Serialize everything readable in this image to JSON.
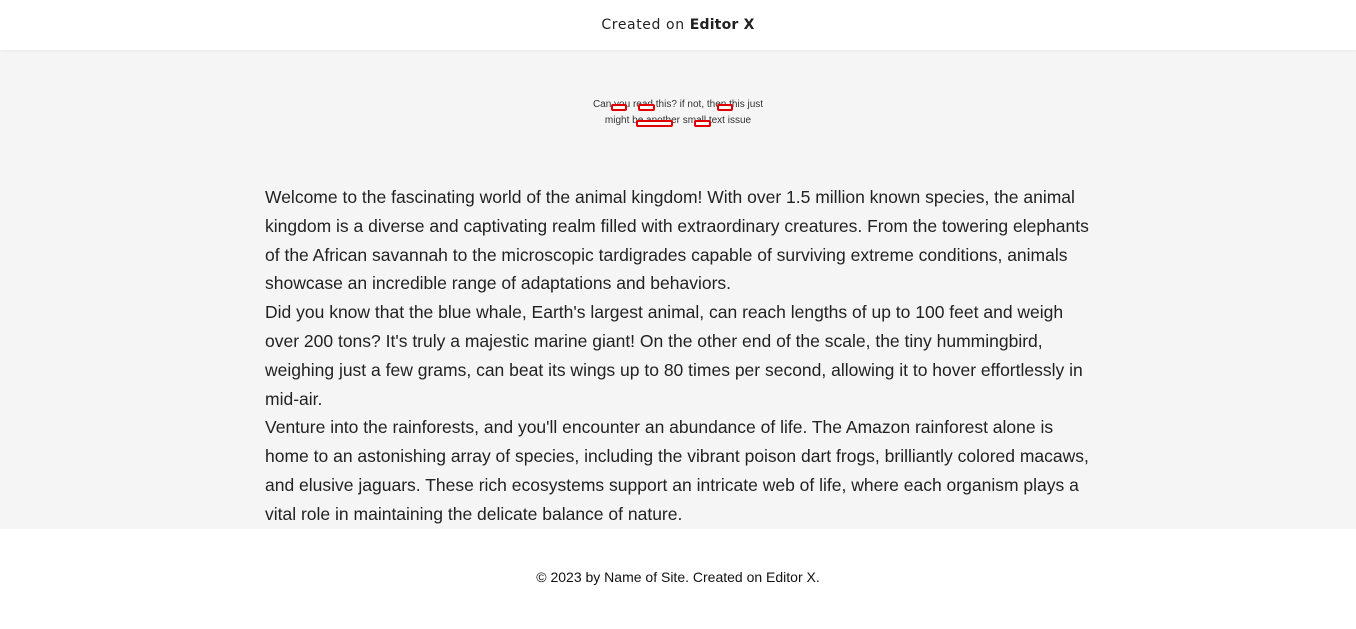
{
  "topbar": {
    "created_label": "Created on",
    "brand": "Editor X"
  },
  "hero": {
    "subtext": "Can you read this? if not, then this just might be another small text issue"
  },
  "article": {
    "paragraphs": [
      "Welcome to the fascinating world of the animal kingdom! With over 1.5 million known species, the animal kingdom is a diverse and captivating realm filled with extraordinary creatures. From the towering elephants of the African savannah to the microscopic tardigrades capable of surviving extreme conditions, animals showcase an incredible range of adaptations and behaviors.",
      "Did you know that the blue whale, Earth's largest animal, can reach lengths of up to 100 feet and weigh over 200 tons? It's truly a majestic marine giant! On the other end of the scale, the tiny hummingbird, weighing just a few grams, can beat its wings up to 80 times per second, allowing it to hover effortlessly in mid-air.",
      "Venture into the rainforests, and you'll encounter an abundance of life. The Amazon rainforest alone is home to an astonishing array of species, including the vibrant poison dart frogs, brilliantly colored macaws, and elusive jaguars. These rich ecosystems support an intricate web of life, where each organism plays a vital role in maintaining the delicate balance of nature."
    ]
  },
  "footer": {
    "text": "© 2023 by Name of Site. Created on Editor X."
  },
  "colors": {
    "content_bg": "#f5f5f5",
    "marker": "#e00000"
  }
}
